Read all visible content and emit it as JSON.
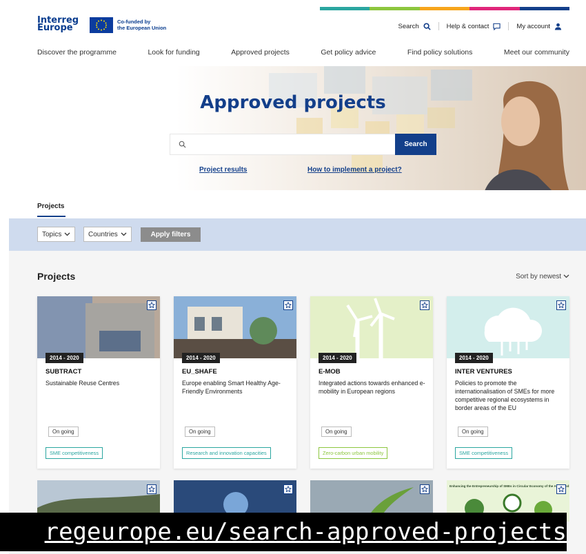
{
  "brand": {
    "logo_line1": "Interreg",
    "logo_line2": "Europe",
    "cofunded_line1": "Co-funded by",
    "cofunded_line2": "the European Union",
    "strip_colors": [
      "#2aa6a0",
      "#8cc63e",
      "#f7a51c",
      "#e0267a",
      "#133f8a"
    ]
  },
  "util_nav": {
    "search": "Search",
    "help": "Help & contact",
    "account": "My account"
  },
  "main_nav": [
    "Discover the programme",
    "Look for funding",
    "Approved projects",
    "Get policy advice",
    "Find policy solutions",
    "Meet our community"
  ],
  "hero": {
    "title": "Approved projects",
    "search_placeholder": "",
    "search_button": "Search",
    "link_results": "Project results",
    "link_implement": "How to implement a project?"
  },
  "tabs": {
    "projects": "Projects"
  },
  "filters": {
    "topics": "Topics",
    "countries": "Countries",
    "apply": "Apply filters"
  },
  "listing": {
    "title": "Projects",
    "sort": "Sort by newest"
  },
  "cards": [
    {
      "period": "2014 - 2020",
      "acronym": "SUBTRACT",
      "description": "Sustainable Reuse Centres",
      "status": "On going",
      "topic": "SME competitiveness",
      "topic_color": "#2aa6a0"
    },
    {
      "period": "2014 - 2020",
      "acronym": "EU_SHAFE",
      "description": "Europe enabling Smart Healthy Age-Friendly Environments",
      "status": "On going",
      "topic": "Research and innovation capacities",
      "topic_color": "#2aa6a0"
    },
    {
      "period": "2014 - 2020",
      "acronym": "E-MOB",
      "description": "Integrated actions towards enhanced e-mobility in European regions",
      "status": "On going",
      "topic": "Zero-carbon urban mobility",
      "topic_color": "#8cc63e"
    },
    {
      "period": "2014 - 2020",
      "acronym": "INTER VENTURES",
      "description": "Policies to promote the internationalisation of SMEs for more competitive regional ecosystems in border areas of the EU",
      "status": "On going",
      "topic": "SME competitiveness",
      "topic_color": "#2aa6a0"
    }
  ],
  "second_row_caption": "Enhancing the Entrepreneurship of SMEs in Circular Economy of the Agri-Food Sector",
  "url_banner": "regeurope.eu/search-approved-projects"
}
